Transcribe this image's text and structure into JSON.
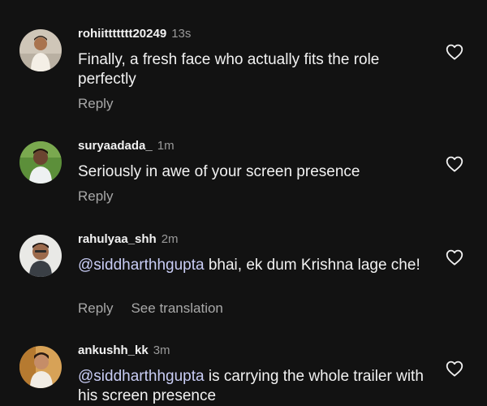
{
  "comments": [
    {
      "username": "rohiittttttt20249",
      "time": "13s",
      "text": "Finally, a fresh face who actually fits the role perfectly",
      "reply_label": "Reply",
      "avatar_icon": "user-avatar-icon"
    },
    {
      "username": "suryaadada_",
      "time": "1m",
      "text": "Seriously in awe of your screen presence",
      "reply_label": "Reply",
      "avatar_icon": "user-avatar-icon"
    },
    {
      "username": "rahulyaa_shh",
      "time": "2m",
      "mention": "@siddharthhgupta",
      "text": " bhai, ek dum Krishna lage che!",
      "reply_label": "Reply",
      "translate_label": "See translation",
      "avatar_icon": "user-avatar-icon"
    },
    {
      "username": "ankushh_kk",
      "time": "3m",
      "mention": "@siddharthhgupta",
      "text": " is carrying the whole trailer with his screen presence",
      "avatar_icon": "user-avatar-icon"
    }
  ],
  "icons": {
    "like": "heart-outline-icon"
  },
  "colors": {
    "background": "#121212",
    "text": "#f2f2f2",
    "secondary": "#a8a8a8",
    "mention": "#c9cdf5"
  }
}
